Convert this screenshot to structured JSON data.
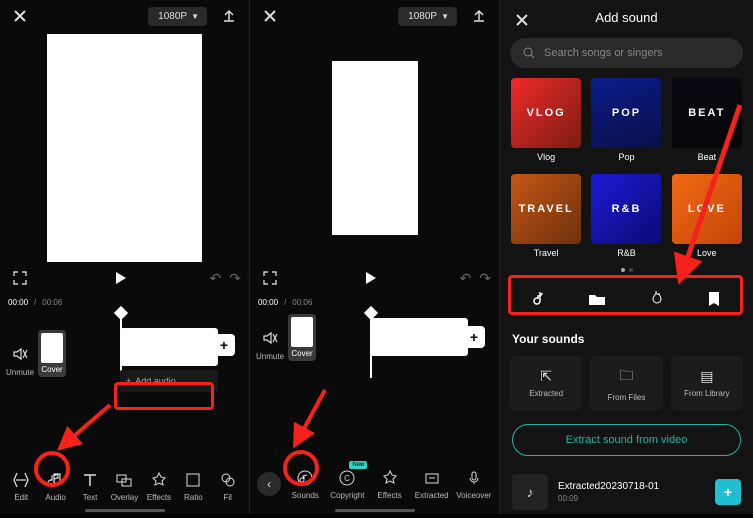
{
  "editor": {
    "resolution": "1080P",
    "time_current": "00:00",
    "time_total": "00:06",
    "unmute_label": "Unmute",
    "cover_label": "Cover",
    "add_audio_label": "Add audio"
  },
  "toolbar_left": {
    "edit": "Edit",
    "audio": "Audio",
    "text": "Text",
    "overlay": "Overlay",
    "effects": "Effects",
    "ratio": "Ratio",
    "filters": "Fil"
  },
  "toolbar_mid": {
    "sounds": "Sounds",
    "copyright": "Copyright",
    "effects": "Effects",
    "extracted": "Extracted",
    "voiceover": "Voiceover",
    "new_badge": "New"
  },
  "right": {
    "title": "Add sound",
    "search_placeholder": "Search songs or singers",
    "categories_row1": [
      {
        "label": "Vlog",
        "overlay": "VLOG",
        "bg": "linear-gradient(135deg,#f02a2a,#7a1c12)"
      },
      {
        "label": "Pop",
        "overlay": "POP",
        "bg": "linear-gradient(160deg,#0b1c8a,#091048)"
      },
      {
        "label": "Beat",
        "overlay": "BEAT",
        "bg": "linear-gradient(180deg,#090911,#060608)"
      }
    ],
    "categories_row2": [
      {
        "label": "Travel",
        "overlay": "TRAVEL",
        "bg": "linear-gradient(135deg,#c45616,#6d310d)"
      },
      {
        "label": "R&B",
        "overlay": "R&B",
        "bg": "linear-gradient(135deg,#191bd6,#0c0b74)"
      },
      {
        "label": "Love",
        "overlay": "LOVE",
        "bg": "linear-gradient(135deg,#f16a13,#c24409)"
      }
    ],
    "your_sounds_title": "Your sounds",
    "sources": {
      "extracted": "Extracted",
      "from_files": "From Files",
      "from_library": "From Library"
    },
    "extract_btn": "Extract sound from video",
    "sound_item": {
      "name": "Extracted20230718-01",
      "duration": "00:09"
    }
  }
}
